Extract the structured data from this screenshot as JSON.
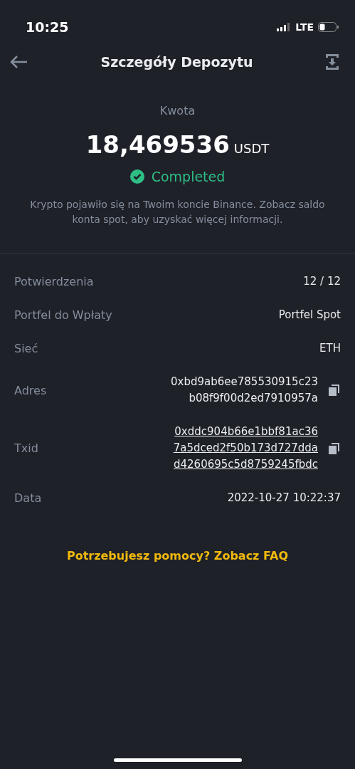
{
  "status_bar": {
    "time": "10:25",
    "network": "LTE"
  },
  "header": {
    "title": "Szczegóły Depozytu"
  },
  "summary": {
    "label": "Kwota",
    "amount": "18,469536",
    "currency": "USDT",
    "status": "Completed",
    "description": "Krypto pojawiło się na Twoim koncie Binance. Zobacz saldo konta spot, aby uzyskać więcej informacji."
  },
  "details": [
    {
      "label": "Potwierdzenia",
      "kind": "text",
      "lines": [
        "12 / 12"
      ]
    },
    {
      "label": "Portfel do Wpłaty",
      "kind": "text",
      "lines": [
        "Portfel Spot"
      ]
    },
    {
      "label": "Sieć",
      "kind": "text",
      "lines": [
        "ETH"
      ]
    },
    {
      "label": "Adres",
      "kind": "copyable",
      "lines": [
        "0xbd9ab6ee785530915c23",
        "b08f9f00d2ed7910957a"
      ]
    },
    {
      "label": "Txid",
      "kind": "link",
      "lines": [
        "0xddc904b66e1bbf81ac36",
        "7a5dced2f50b173d727dda",
        "d4260695c5d8759245fbdc"
      ]
    },
    {
      "label": "Data",
      "kind": "text",
      "lines": [
        "2022-10-27 10:22:37"
      ]
    }
  ],
  "help_link": "Potrzebujesz pomocy? Zobacz FAQ"
}
